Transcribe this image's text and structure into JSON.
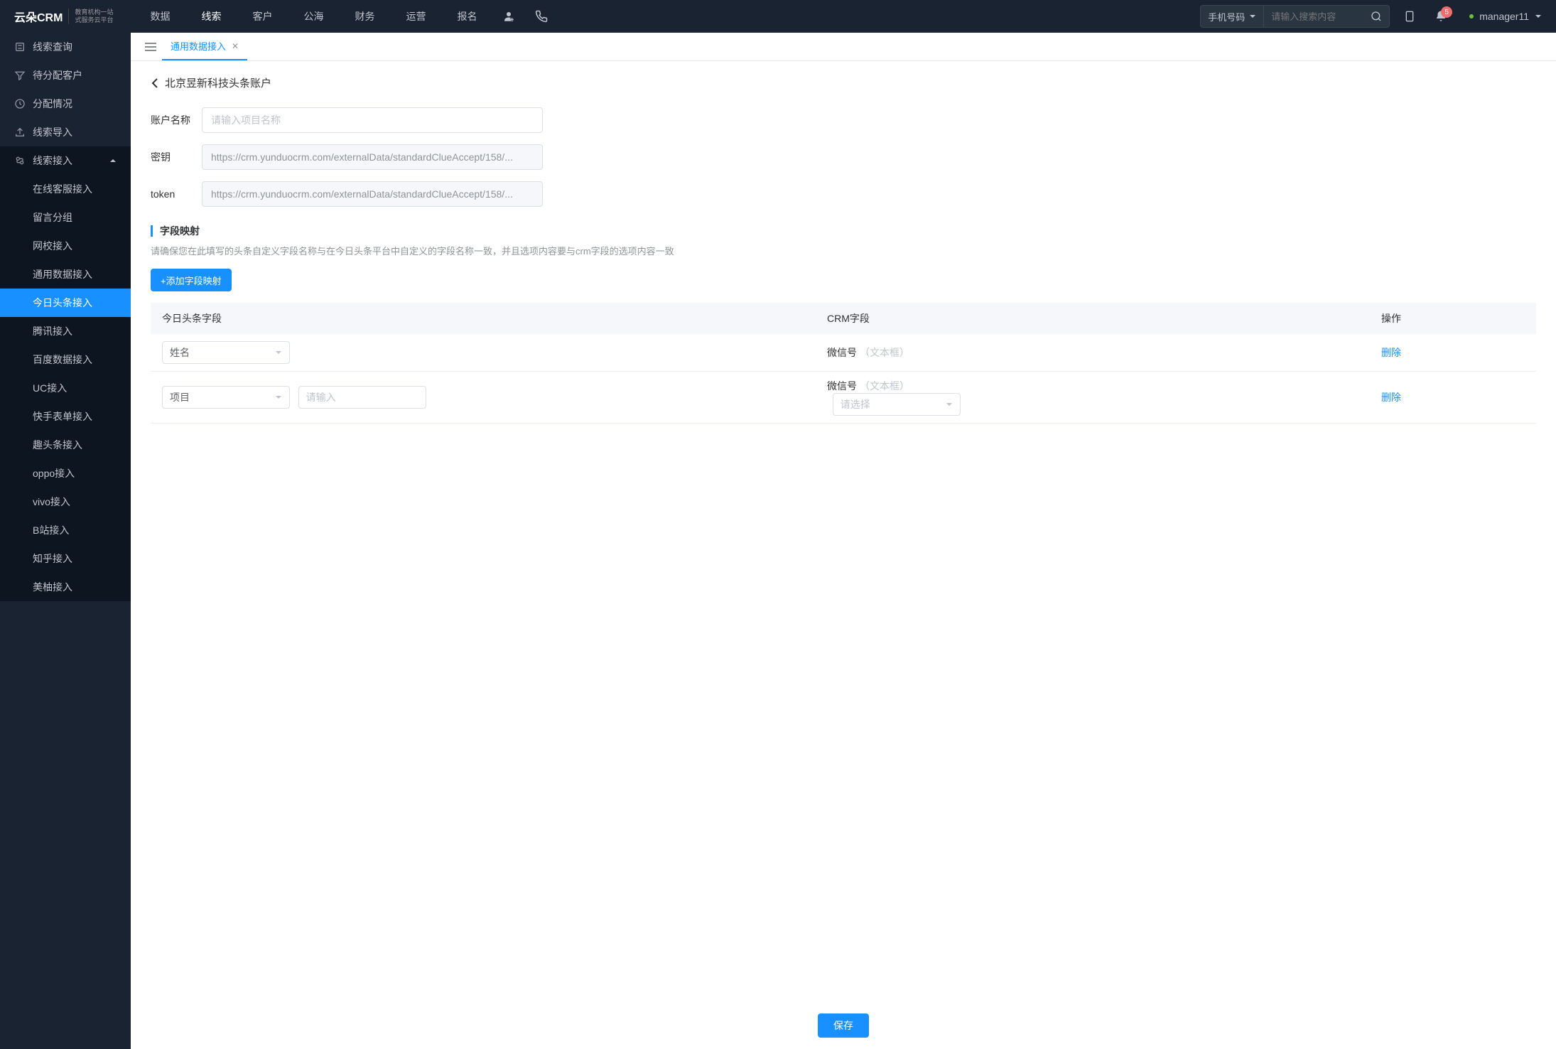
{
  "header": {
    "logo": "云朵CRM",
    "logo_sub1": "教育机构一站",
    "logo_sub2": "式服务云平台",
    "nav": [
      "数据",
      "线索",
      "客户",
      "公海",
      "财务",
      "运营",
      "报名"
    ],
    "nav_active_index": 1,
    "search_type": "手机号码",
    "search_placeholder": "请输入搜索内容",
    "notification_count": "5",
    "username": "manager11"
  },
  "sidebar": {
    "items": [
      {
        "label": "线索查询",
        "icon": "search"
      },
      {
        "label": "待分配客户",
        "icon": "filter"
      },
      {
        "label": "分配情况",
        "icon": "clock"
      },
      {
        "label": "线索导入",
        "icon": "upload"
      },
      {
        "label": "线索接入",
        "icon": "plug",
        "expanded": true
      }
    ],
    "sub_items": [
      "在线客服接入",
      "留言分组",
      "网校接入",
      "通用数据接入",
      "今日头条接入",
      "腾讯接入",
      "百度数据接入",
      "UC接入",
      "快手表单接入",
      "趣头条接入",
      "oppo接入",
      "vivo接入",
      "B站接入",
      "知乎接入",
      "美柚接入"
    ],
    "sub_active_index": 4
  },
  "tabs": {
    "items": [
      "通用数据接入"
    ]
  },
  "page": {
    "breadcrumb_title": "北京昱新科技头条账户",
    "form": {
      "account_label": "账户名称",
      "account_placeholder": "请输入项目名称",
      "secret_label": "密钥",
      "secret_value": "https://crm.yunduocrm.com/externalData/standardClueAccept/158/...",
      "token_label": "token",
      "token_value": "https://crm.yunduocrm.com/externalData/standardClueAccept/158/..."
    },
    "mapping": {
      "section_title": "字段映射",
      "section_desc": "请确保您在此填写的头条自定义字段名称与在今日头条平台中自定义的字段名称一致，并且选项内容要与crm字段的选项内容一致",
      "add_button": "+添加字段映射",
      "columns": {
        "col1": "今日头条字段",
        "col2": "CRM字段",
        "col3": "操作"
      },
      "rows": [
        {
          "toutiao_field": "姓名",
          "extra_input": false,
          "crm_label": "微信号",
          "crm_hint": "（文本框）",
          "crm_select": false
        },
        {
          "toutiao_field": "项目",
          "extra_input": true,
          "extra_placeholder": "请输入",
          "crm_label": "微信号",
          "crm_hint": "（文本框）",
          "crm_select": true,
          "crm_select_placeholder": "请选择"
        }
      ],
      "delete_label": "删除"
    },
    "save_button": "保存"
  }
}
